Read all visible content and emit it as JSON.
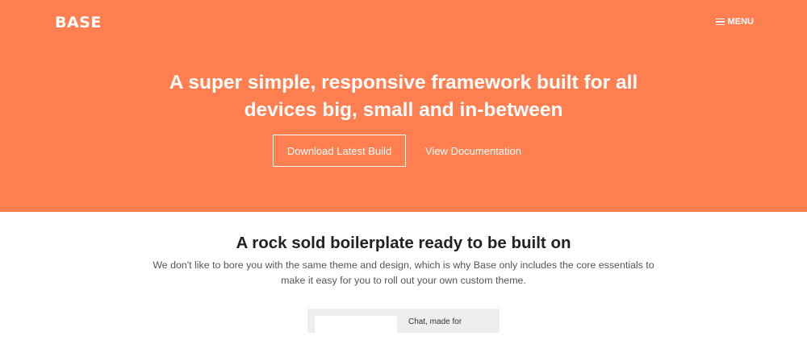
{
  "header": {
    "logo": "BASE",
    "menu_label": "MENU"
  },
  "hero": {
    "headline": "A super simple, responsive framework built for all devices big, small and in-between",
    "primary_button": "Download Latest Build",
    "secondary_button": "View Documentation"
  },
  "intro": {
    "title": "A rock sold boilerplate ready to be built on",
    "description": "We don't like to bore you with the same theme and design, which is why Base only includes the core essentials to make it easy for you to roll out your own custom theme."
  },
  "preview": {
    "text": "Chat, made for"
  },
  "colors": {
    "hero_background": "#ff7f50",
    "text_on_hero": "#ffffff",
    "title_text": "#222222",
    "body_text": "#555555"
  },
  "icons": {
    "menu": "hamburger-icon"
  }
}
